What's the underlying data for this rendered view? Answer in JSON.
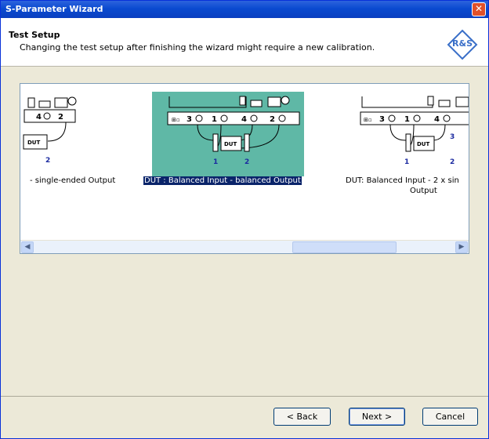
{
  "window": {
    "title": "S-Parameter Wizard"
  },
  "header": {
    "title": "Test Setup",
    "subtitle": "Changing the test setup after finishing the wizard might require a new calibration."
  },
  "setups": [
    {
      "label": "- single-ended Output",
      "selected": false
    },
    {
      "label": "DUT : Balanced Input - balanced Output",
      "selected": true
    },
    {
      "label": "DUT: Balanced Input - 2 x sin",
      "label2": "Output",
      "selected": false
    }
  ],
  "diagram": {
    "dut": "DUT",
    "ports": {
      "p1": "1",
      "p2": "2",
      "p3": "3",
      "p4": "4"
    }
  },
  "buttons": {
    "back": "< Back",
    "next": "Next >",
    "cancel": "Cancel"
  },
  "colors": {
    "selection_bg": "#5fb8a6",
    "title_bar": "#0a4ad0"
  }
}
